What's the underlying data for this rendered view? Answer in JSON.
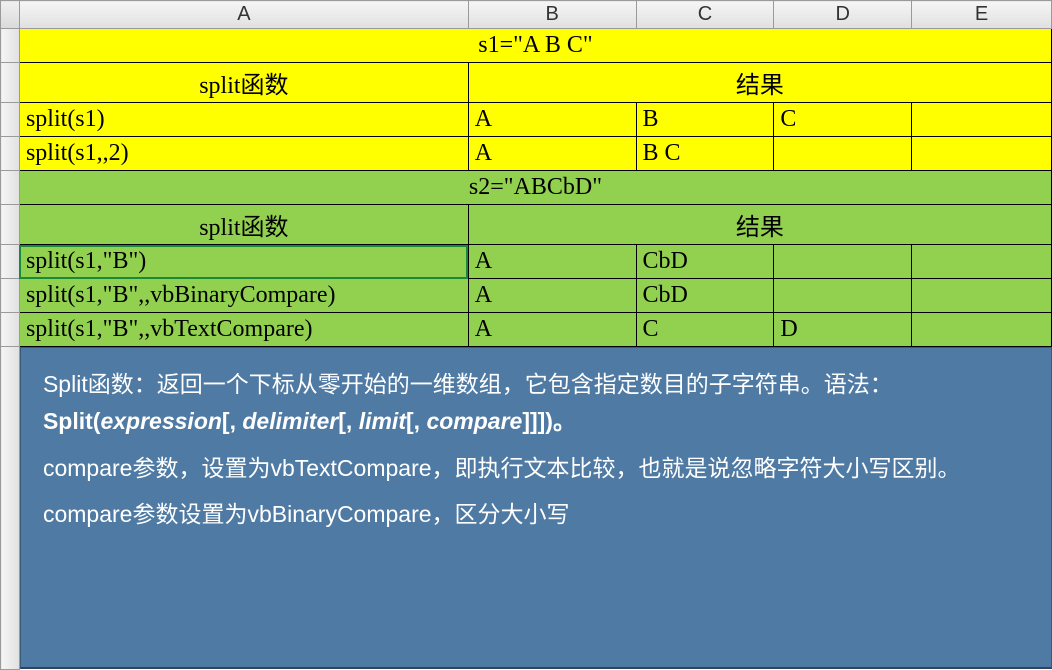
{
  "columns": {
    "a": "A",
    "b": "B",
    "c": "C",
    "d": "D",
    "e": "E"
  },
  "section1": {
    "title": "s1=\"A B C\"",
    "header_left": "split函数",
    "header_right": "结果",
    "rows": [
      {
        "func": "split(s1)",
        "b": "A",
        "c": "B",
        "d": "C",
        "e": ""
      },
      {
        "func": "split(s1,,2)",
        "b": "A",
        "c": "B C",
        "d": "",
        "e": ""
      }
    ]
  },
  "section2": {
    "title": "s2=\"ABCbD\"",
    "header_left": "split函数",
    "header_right": "结果",
    "rows": [
      {
        "func": "split(s1,\"B\")",
        "b": "A",
        "c": "CbD",
        "d": "",
        "e": ""
      },
      {
        "func": "split(s1,\"B\",,vbBinaryCompare)",
        "b": "A",
        "c": "CbD",
        "d": "",
        "e": ""
      },
      {
        "func": "split(s1,\"B\",,vbTextCompare)",
        "b": "A",
        "c": "C",
        "d": "D",
        "e": ""
      }
    ]
  },
  "info": {
    "line1_pre": "Split函数：返回一个下标从零开始的一维数组，它包含指定数目的子字符串。语法：",
    "line1_syntax_1": "Split(",
    "line1_syntax_2": "expression",
    "line1_syntax_3": "[, ",
    "line1_syntax_4": "delimiter",
    "line1_syntax_5": "[, ",
    "line1_syntax_6": "limit",
    "line1_syntax_7": "[, ",
    "line1_syntax_8": "compare",
    "line1_syntax_9": "]]])。",
    "line2": "compare参数，设置为vbTextCompare，即执行文本比较，也就是说忽略字符大小写区别。",
    "line3": "compare参数设置为vbBinaryCompare，区分大小写"
  }
}
